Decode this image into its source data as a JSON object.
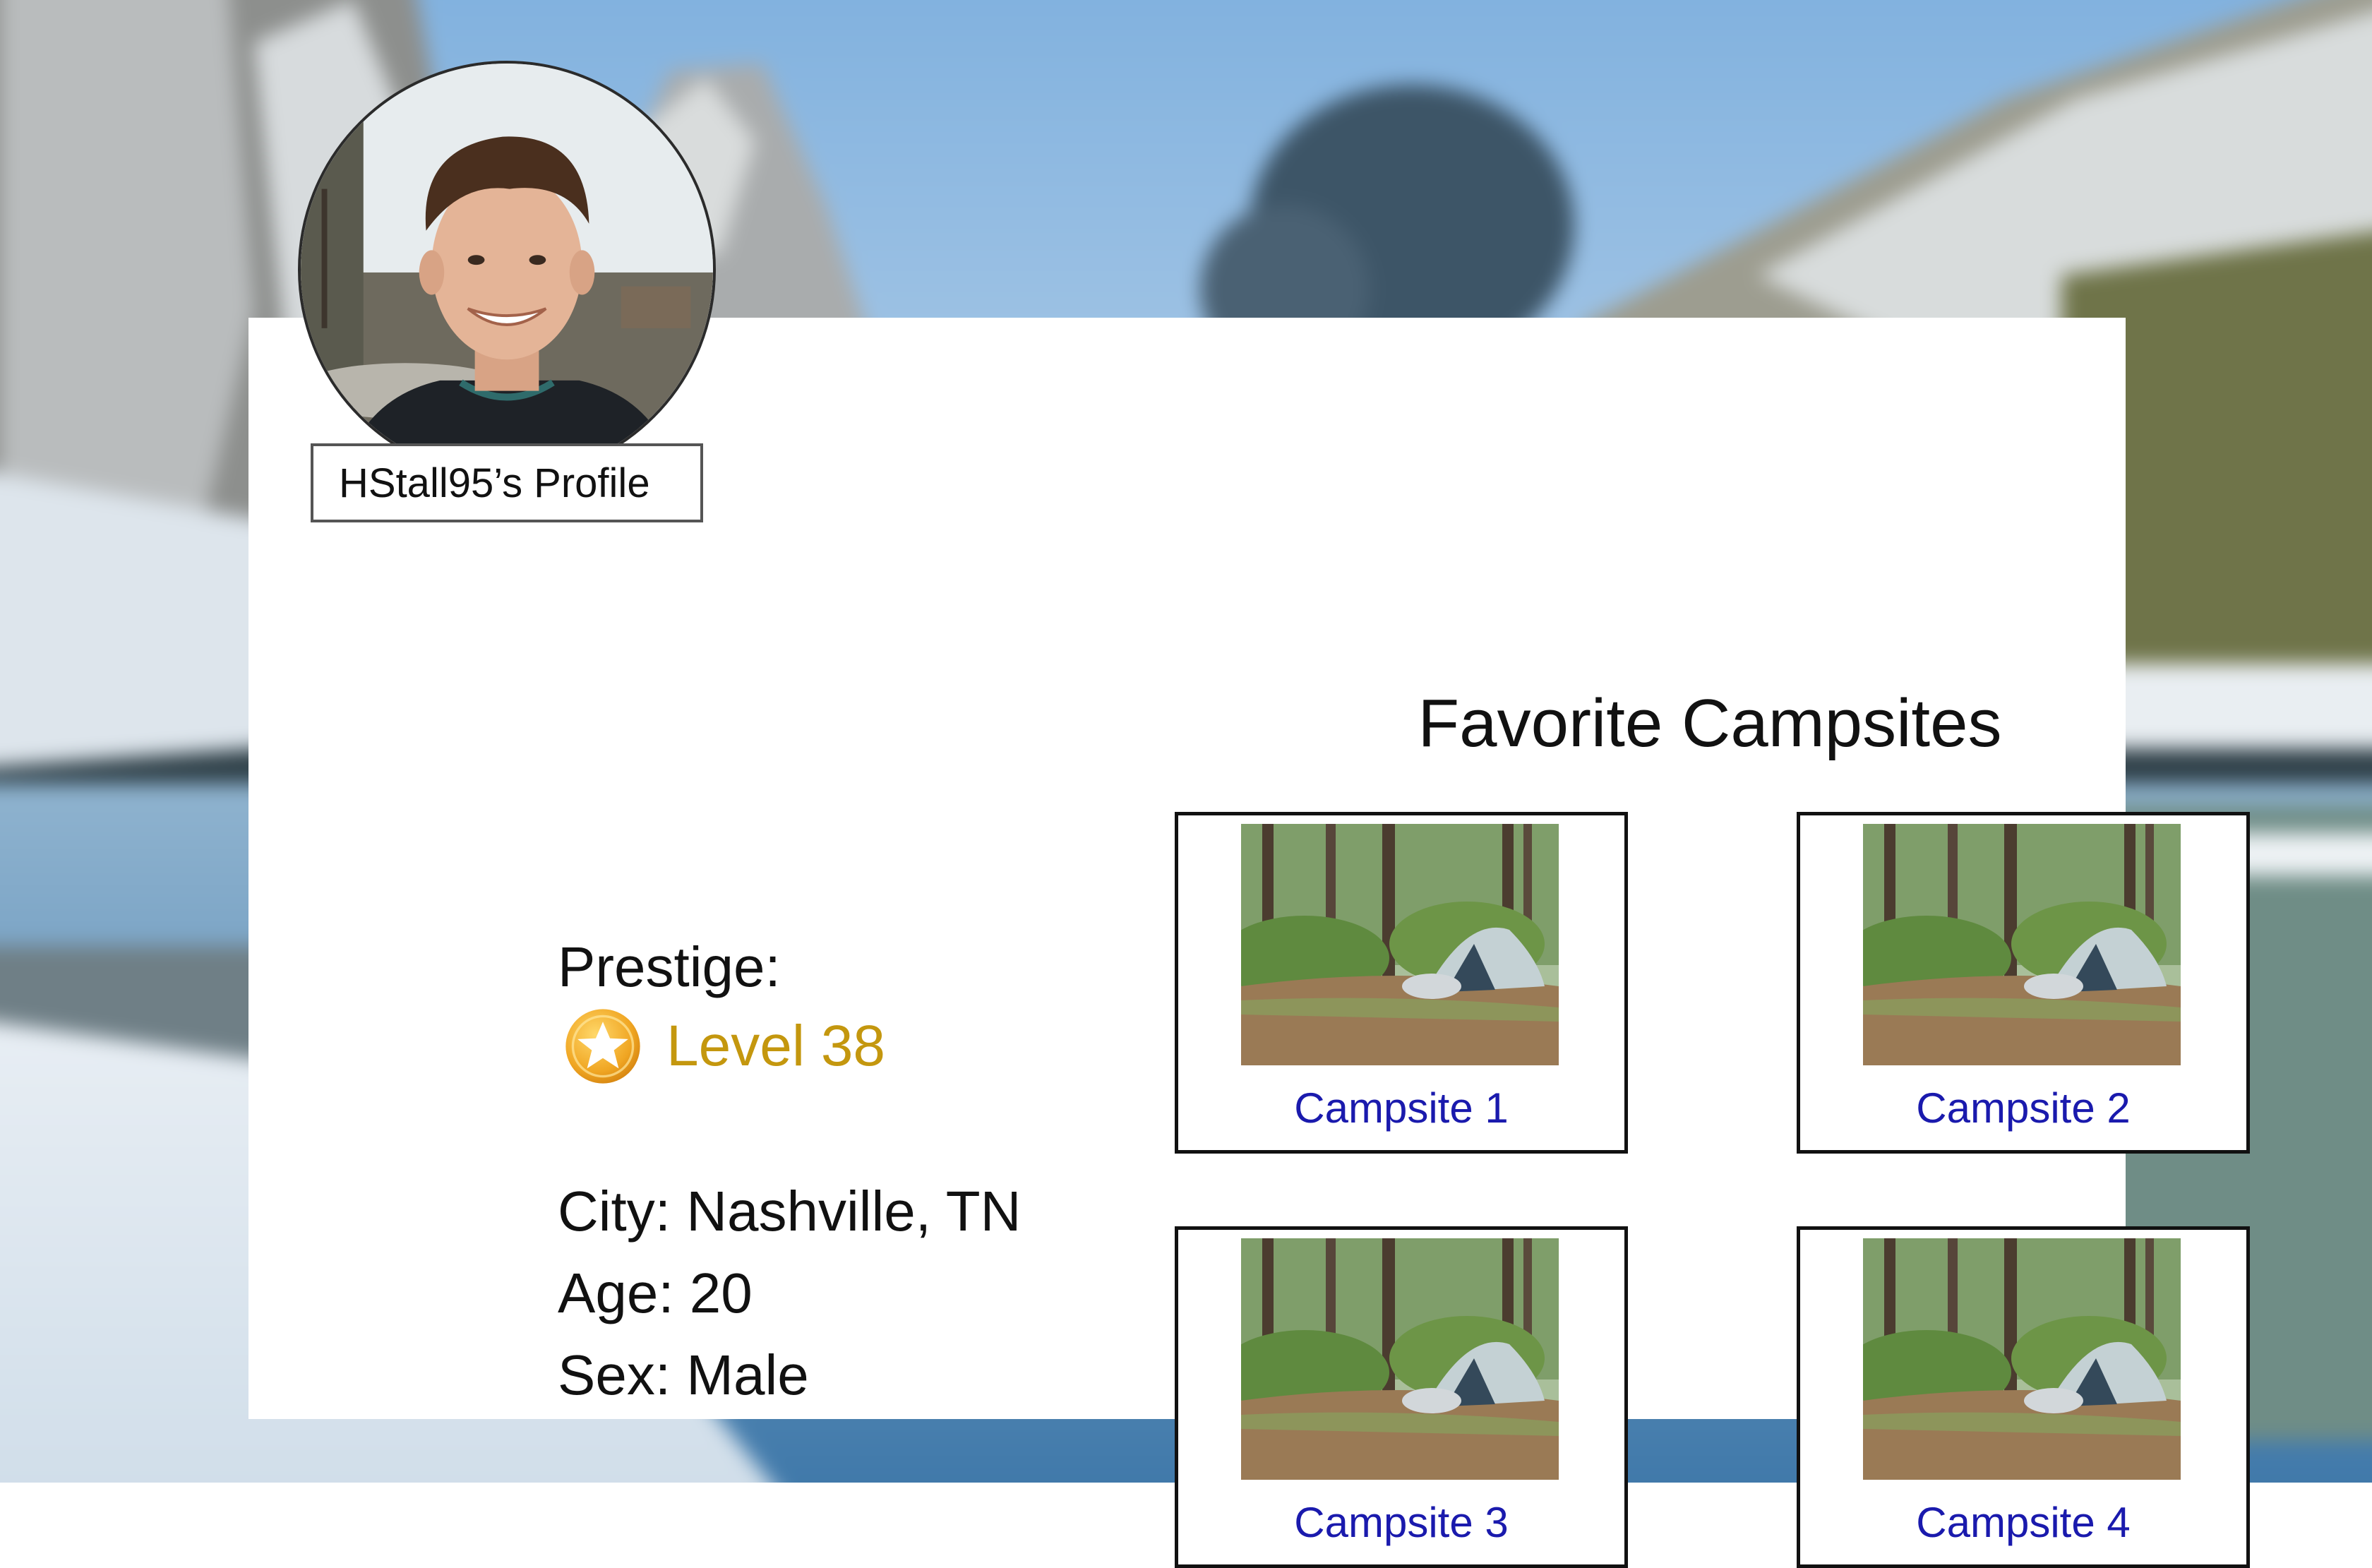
{
  "profile": {
    "tag": "HStall95’s Profile",
    "prestige_label": "Prestige:",
    "level": "Level 38",
    "city": "City: Nashville, TN",
    "age": "Age: 20",
    "sex": "Sex: Male"
  },
  "favorites": {
    "title": "Favorite Campsites",
    "items": [
      {
        "label": "Campsite 1"
      },
      {
        "label": "Campsite 2"
      },
      {
        "label": "Campsite 3"
      },
      {
        "label": "Campsite 4"
      }
    ]
  },
  "colors": {
    "level": "#c4970e",
    "link": "#1a1aad",
    "card": "#ffffff"
  },
  "icons": {
    "prestige": "star-badge-icon"
  }
}
